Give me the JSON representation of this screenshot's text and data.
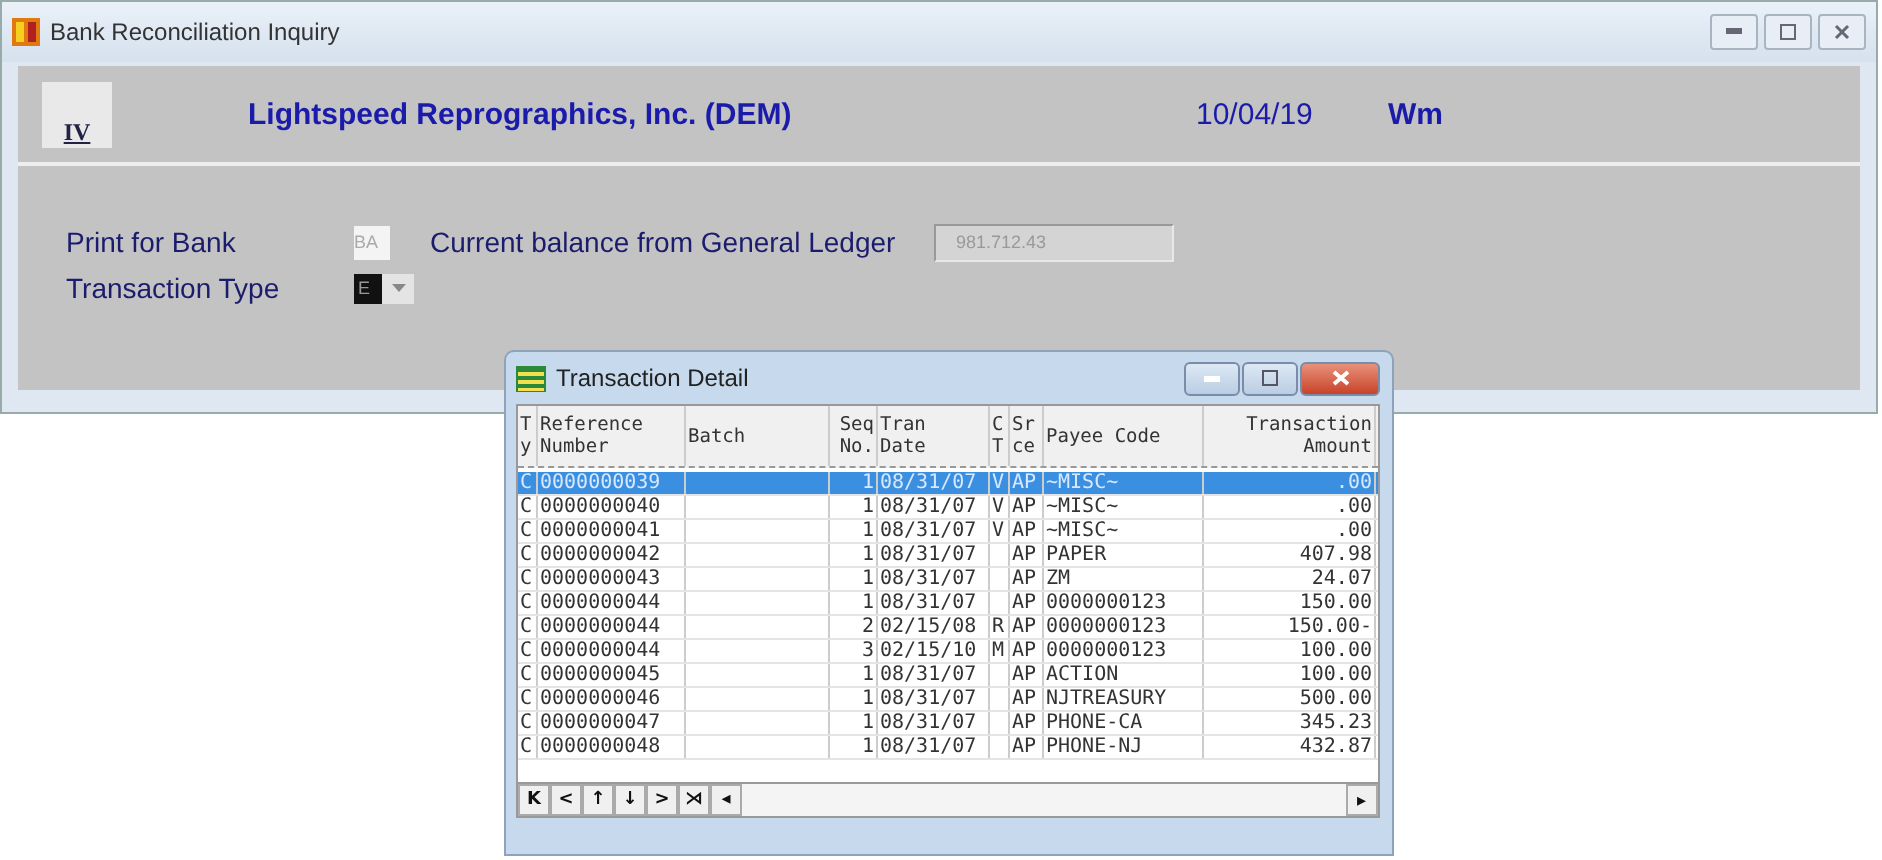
{
  "window": {
    "title": "Bank Reconciliation Inquiry"
  },
  "header": {
    "logo_text": "IV",
    "company": "Lightspeed Reprographics, Inc. (DEM)",
    "date": "10/04/19",
    "user": "Wm"
  },
  "form": {
    "bank_label": "Print for Bank",
    "bank_value": "BA",
    "balance_label": "Current balance from General Ledger",
    "balance_value": "981.712.43",
    "type_label": "Transaction Type",
    "type_value": "E"
  },
  "detail": {
    "title": "Transaction Detail",
    "columns": [
      "T\ny",
      "Reference\nNumber",
      "Batch",
      "Seq\nNo.",
      "Tran\nDate",
      "C\nT",
      "Sr\nce",
      "Payee Code",
      "Transaction\nAmount"
    ],
    "rows": [
      {
        "selected": true,
        "cells": [
          "C",
          "0000000039",
          "",
          "1",
          "08/31/07",
          "V",
          "AP",
          "~MISC~",
          ".00"
        ]
      },
      {
        "selected": false,
        "cells": [
          "C",
          "0000000040",
          "",
          "1",
          "08/31/07",
          "V",
          "AP",
          "~MISC~",
          ".00"
        ]
      },
      {
        "selected": false,
        "cells": [
          "C",
          "0000000041",
          "",
          "1",
          "08/31/07",
          "V",
          "AP",
          "~MISC~",
          ".00"
        ]
      },
      {
        "selected": false,
        "cells": [
          "C",
          "0000000042",
          "",
          "1",
          "08/31/07",
          "",
          "AP",
          "PAPER",
          "407.98"
        ]
      },
      {
        "selected": false,
        "cells": [
          "C",
          "0000000043",
          "",
          "1",
          "08/31/07",
          "",
          "AP",
          "ZM",
          "24.07"
        ]
      },
      {
        "selected": false,
        "cells": [
          "C",
          "0000000044",
          "",
          "1",
          "08/31/07",
          "",
          "AP",
          "0000000123",
          "150.00"
        ]
      },
      {
        "selected": false,
        "cells": [
          "C",
          "0000000044",
          "",
          "2",
          "02/15/08",
          "R",
          "AP",
          "0000000123",
          "150.00-"
        ]
      },
      {
        "selected": false,
        "cells": [
          "C",
          "0000000044",
          "",
          "3",
          "02/15/10",
          "M",
          "AP",
          "0000000123",
          "100.00"
        ]
      },
      {
        "selected": false,
        "cells": [
          "C",
          "0000000045",
          "",
          "1",
          "08/31/07",
          "",
          "AP",
          "ACTION",
          "100.00"
        ]
      },
      {
        "selected": false,
        "cells": [
          "C",
          "0000000046",
          "",
          "1",
          "08/31/07",
          "",
          "AP",
          "NJTREASURY",
          "500.00"
        ]
      },
      {
        "selected": false,
        "cells": [
          "C",
          "0000000047",
          "",
          "1",
          "08/31/07",
          "",
          "AP",
          "PHONE-CA",
          "345.23"
        ]
      },
      {
        "selected": false,
        "cells": [
          "C",
          "0000000048",
          "",
          "1",
          "08/31/07",
          "",
          "AP",
          "PHONE-NJ",
          "432.87"
        ]
      }
    ],
    "nav_buttons": [
      "K",
      "<",
      "↑",
      "↓",
      ">",
      "⋊",
      "◂"
    ],
    "scroll_right": "▸"
  }
}
